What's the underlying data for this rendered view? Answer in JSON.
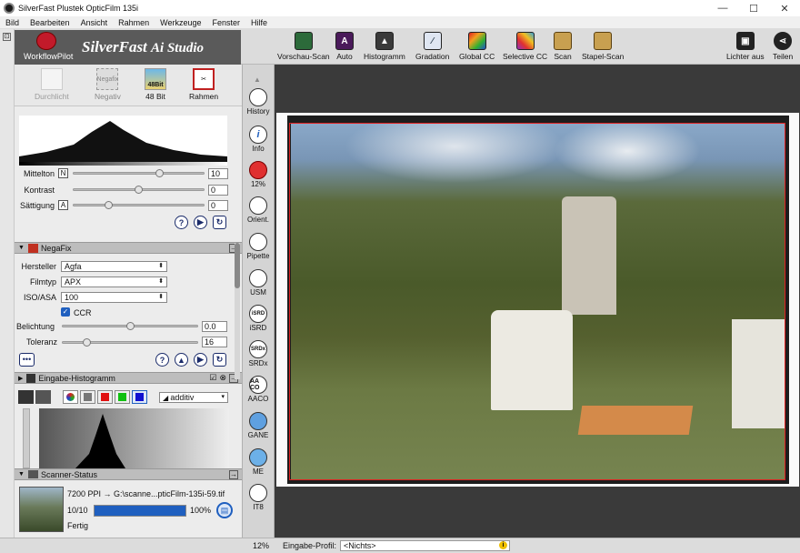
{
  "window": {
    "title": "SilverFast  Plustek OpticFilm 135i",
    "minimize": "—",
    "maximize": "☐",
    "close": "✕"
  },
  "menu": [
    "Bild",
    "Bearbeiten",
    "Ansicht",
    "Rahmen",
    "Werkzeuge",
    "Fenster",
    "Hilfe"
  ],
  "logo": {
    "workflow": "WorkflowPilot",
    "brand": "SilverFast",
    "brand_suffix": "Ai Studio"
  },
  "toolbar": [
    {
      "label": "Vorschau-Scan",
      "icon": "prescan-icon",
      "color": "#2c6a3a"
    },
    {
      "label": "Auto",
      "icon": "auto-icon",
      "color": "#6a2a80"
    },
    {
      "label": "Histogramm",
      "icon": "histogram-icon",
      "color": "#3a3a3a"
    },
    {
      "label": "Gradation",
      "icon": "gradation-icon",
      "color": "#3a4a7a"
    },
    {
      "label": "Global CC",
      "icon": "global-cc-icon",
      "color": "#c03030"
    },
    {
      "label": "Selective CC",
      "icon": "selective-cc-icon",
      "color": "#8a3ab0"
    },
    {
      "label": "Scan",
      "icon": "scan-icon",
      "color": "#8a6a2a"
    },
    {
      "label": "Stapel-Scan",
      "icon": "batch-scan-icon",
      "color": "#8a6a2a"
    }
  ],
  "toolbar_right": [
    {
      "label": "Lichter aus",
      "icon": "lights-off-icon"
    },
    {
      "label": "Teilen",
      "icon": "share-icon"
    }
  ],
  "modes": [
    {
      "label": "Durchlicht",
      "icon": "transparency-icon"
    },
    {
      "label": "Negativ",
      "icon": "negative-icon"
    },
    {
      "label": "48 Bit",
      "icon": "48bit-icon"
    },
    {
      "label": "Rahmen",
      "icon": "frame-tool-icon"
    }
  ],
  "mode_48bit_badge": "48Bit",
  "mode_negativ_badge": "Negafix",
  "tone": {
    "mittelton_label": "Mittelton",
    "mittelton_mode": "N",
    "mittelton_value": "10",
    "kontrast_label": "Kontrast",
    "kontrast_value": "0",
    "saettigung_label": "Sättigung",
    "saettigung_mode": "A",
    "saettigung_value": "0"
  },
  "negafix": {
    "title": "NegaFix",
    "hersteller_label": "Hersteller",
    "hersteller_value": "Agfa",
    "filmtyp_label": "Filmtyp",
    "filmtyp_value": "APX",
    "iso_label": "ISO/ASA",
    "iso_value": "100",
    "ccr_label": "CCR",
    "belichtung_label": "Belichtung",
    "belichtung_value": "0.0",
    "toleranz_label": "Toleranz",
    "toleranz_value": "16",
    "more_label": "•••"
  },
  "input_histogram": {
    "title": "Eingabe-Histogramm",
    "mode_value": "additiv"
  },
  "scanner_status": {
    "title": "Scanner-Status",
    "file": "7200 PPI → G:\\scanne...pticFilm-135i-59.tif",
    "count": "10/10",
    "percent": "100%",
    "state": "Fertig",
    "progress": 1.0
  },
  "toolstrip": [
    {
      "label": "History",
      "icon": "history-icon"
    },
    {
      "label": "Info",
      "icon": "info-icon",
      "glyph": "i"
    },
    {
      "label": "12%",
      "icon": "zoom-icon"
    },
    {
      "label": "Orient.",
      "icon": "orientation-icon"
    },
    {
      "label": "Pipette",
      "icon": "pipette-icon"
    },
    {
      "label": "USM",
      "icon": "usm-icon"
    },
    {
      "label": "iSRD",
      "icon": "isrd-icon",
      "glyph": "iSRD"
    },
    {
      "label": "SRDx",
      "icon": "srdx-icon",
      "glyph": "SRDx"
    },
    {
      "label": "AACO",
      "icon": "aaco-icon",
      "glyph": "AA CO"
    },
    {
      "label": "GANE",
      "icon": "gane-icon"
    },
    {
      "label": "ME",
      "icon": "me-icon"
    },
    {
      "label": "IT8",
      "icon": "it8-icon"
    }
  ],
  "status": {
    "zoom": "12%",
    "profile_label": "Eingabe-Profil:",
    "profile_value": "<Nichts>"
  },
  "colors": {
    "accent": "#1f5fbf",
    "frame": "#e02020",
    "panel": "#ececec"
  }
}
